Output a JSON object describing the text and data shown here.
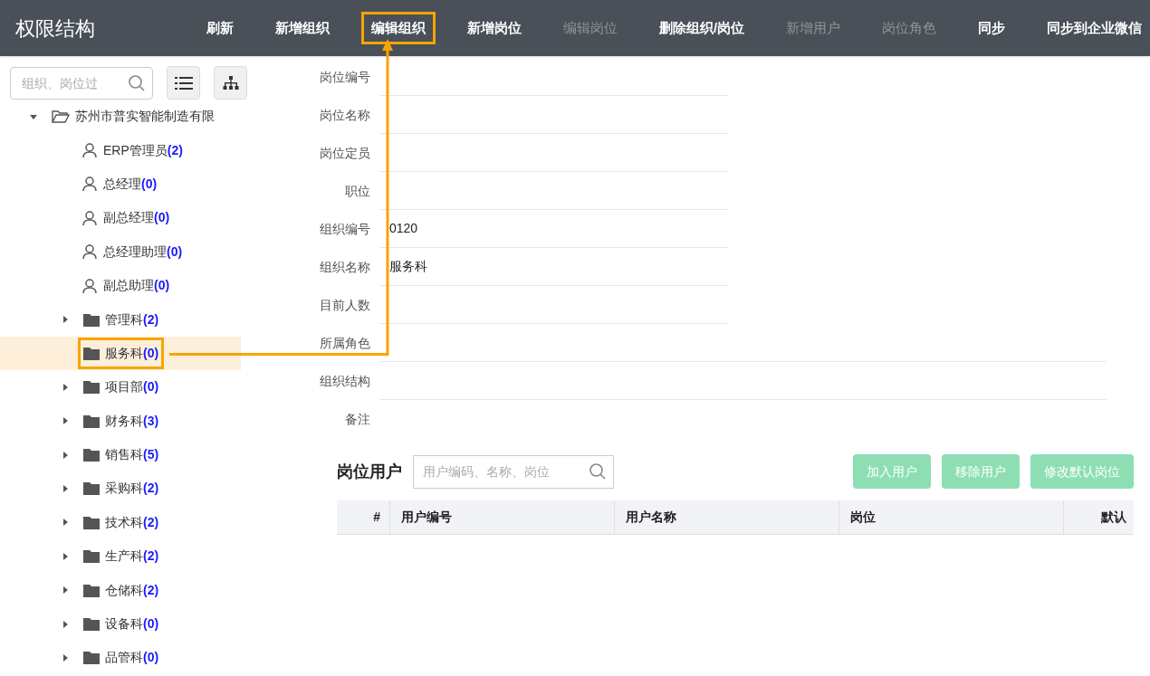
{
  "header": {
    "title": "权限结构",
    "actions": [
      {
        "label": "刷新",
        "disabled": false,
        "highlighted": false
      },
      {
        "label": "新增组织",
        "disabled": false,
        "highlighted": false
      },
      {
        "label": "编辑组织",
        "disabled": false,
        "highlighted": true
      },
      {
        "label": "新增岗位",
        "disabled": false,
        "highlighted": false
      },
      {
        "label": "编辑岗位",
        "disabled": true,
        "highlighted": false
      },
      {
        "label": "删除组织/岗位",
        "disabled": false,
        "highlighted": false
      },
      {
        "label": "新增用户",
        "disabled": true,
        "highlighted": false
      },
      {
        "label": "岗位角色",
        "disabled": true,
        "highlighted": false
      },
      {
        "label": "同步",
        "disabled": false,
        "highlighted": false
      },
      {
        "label": "同步到企业微信",
        "disabled": false,
        "highlighted": false
      }
    ]
  },
  "sidebar": {
    "search": {
      "placeholder": "组织、岗位过"
    },
    "tree": [
      {
        "kind": "org",
        "name": "苏州市普实智能制造有限",
        "expanded": true,
        "selected": false,
        "highlighted": false,
        "children": [
          {
            "kind": "position",
            "name": "ERP管理员",
            "count": "(2)",
            "selected": false,
            "highlighted": false
          },
          {
            "kind": "position",
            "name": "总经理",
            "count": "(0)",
            "selected": false,
            "highlighted": false
          },
          {
            "kind": "position",
            "name": "副总经理",
            "count": "(0)",
            "selected": false,
            "highlighted": false
          },
          {
            "kind": "position",
            "name": "总经理助理",
            "count": "(0)",
            "selected": false,
            "highlighted": false
          },
          {
            "kind": "position",
            "name": "副总助理",
            "count": "(0)",
            "selected": false,
            "highlighted": false
          },
          {
            "kind": "org",
            "name": "管理科",
            "count": "(2)",
            "expanded": false,
            "selected": false,
            "highlighted": false
          },
          {
            "kind": "org",
            "name": "服务科",
            "count": "(0)",
            "selected": true,
            "highlighted": true
          },
          {
            "kind": "org",
            "name": "项目部",
            "count": "(0)",
            "expanded": false,
            "selected": false,
            "highlighted": false
          },
          {
            "kind": "org",
            "name": "财务科",
            "count": "(3)",
            "expanded": false,
            "selected": false,
            "highlighted": false
          },
          {
            "kind": "org",
            "name": "销售科",
            "count": "(5)",
            "expanded": false,
            "selected": false,
            "highlighted": false
          },
          {
            "kind": "org",
            "name": "采购科",
            "count": "(2)",
            "expanded": false,
            "selected": false,
            "highlighted": false
          },
          {
            "kind": "org",
            "name": "技术科",
            "count": "(2)",
            "expanded": false,
            "selected": false,
            "highlighted": false
          },
          {
            "kind": "org",
            "name": "生产科",
            "count": "(2)",
            "expanded": false,
            "selected": false,
            "highlighted": false
          },
          {
            "kind": "org",
            "name": "仓储科",
            "count": "(2)",
            "expanded": false,
            "selected": false,
            "highlighted": false
          },
          {
            "kind": "org",
            "name": "设备科",
            "count": "(0)",
            "expanded": false,
            "selected": false,
            "highlighted": false
          },
          {
            "kind": "org",
            "name": "品管科",
            "count": "(0)",
            "expanded": false,
            "selected": false,
            "highlighted": false
          }
        ]
      }
    ]
  },
  "form": {
    "fields": [
      {
        "label": "岗位编号",
        "kind": "short"
      },
      {
        "label": "岗位名称",
        "kind": "short"
      },
      {
        "label": "岗位定员",
        "kind": "short"
      },
      {
        "label": "职位",
        "kind": "short"
      },
      {
        "label": "组织编号",
        "value": "0120",
        "kind": "short"
      },
      {
        "label": "组织名称",
        "value": "服务科",
        "kind": "short"
      },
      {
        "label": "目前人数",
        "kind": "short"
      },
      {
        "label": "所属角色",
        "kind": "long"
      },
      {
        "label": "组织结构",
        "kind": "long"
      },
      {
        "label": "备注",
        "kind": "long"
      }
    ]
  },
  "users": {
    "title": "岗位用户",
    "search": {
      "placeholder": "用户编码、名称、岗位"
    },
    "buttons": [
      {
        "label": "加入用户",
        "disabled": true
      },
      {
        "label": "移除用户",
        "disabled": true
      },
      {
        "label": "修改默认岗位",
        "disabled": true
      }
    ],
    "table": {
      "columns": [
        "#",
        "用户编号",
        "用户名称",
        "岗位",
        "默认"
      ]
    }
  }
}
